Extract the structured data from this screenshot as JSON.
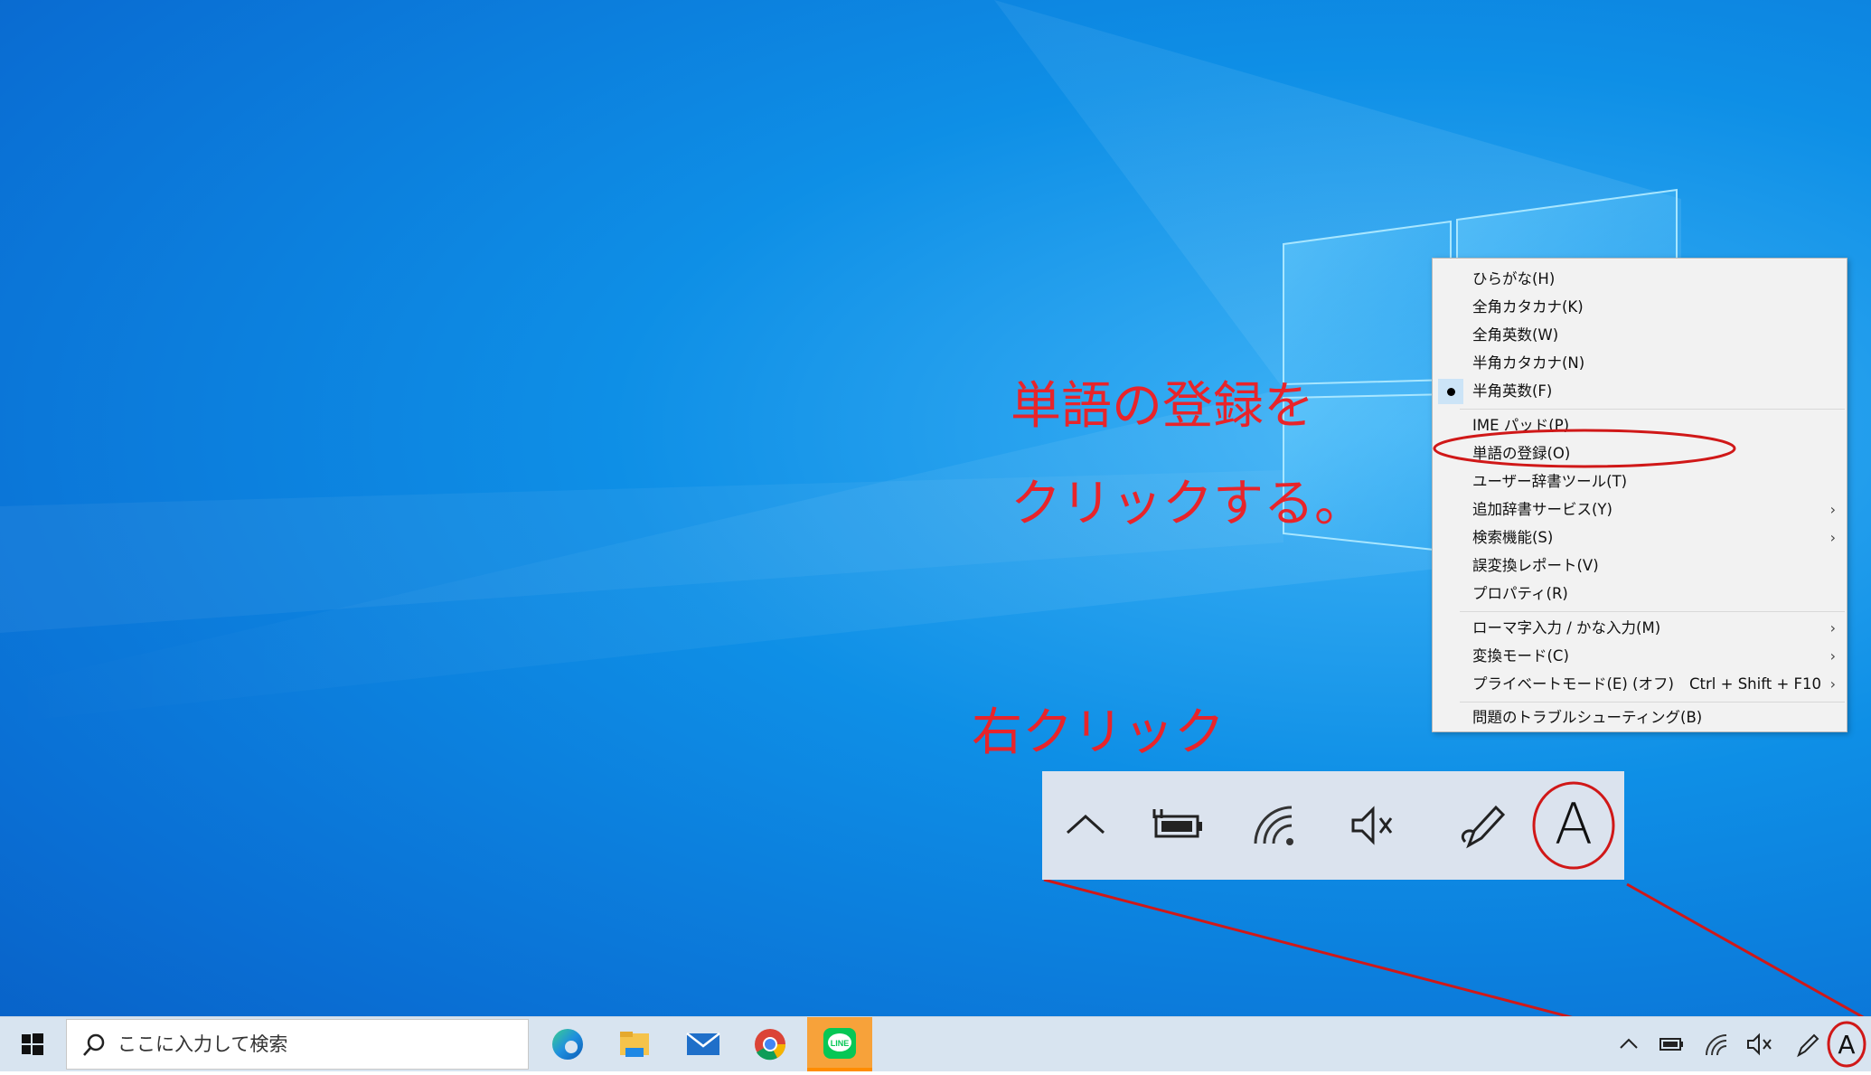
{
  "ime_menu": {
    "items": [
      {
        "label": "ひらがな(H)"
      },
      {
        "label": "全角カタカナ(K)"
      },
      {
        "label": "全角英数(W)"
      },
      {
        "label": "半角カタカナ(N)"
      },
      {
        "label": "半角英数(F)",
        "selected": true
      },
      {
        "label": "IME パッド(P)"
      },
      {
        "label": "単語の登録(O)"
      },
      {
        "label": "ユーザー辞書ツール(T)"
      },
      {
        "label": "追加辞書サービス(Y)",
        "submenu": true
      },
      {
        "label": "検索機能(S)",
        "submenu": true
      },
      {
        "label": "誤変換レポート(V)"
      },
      {
        "label": "プロパティ(R)"
      },
      {
        "label": "ローマ字入力 / かな入力(M)",
        "submenu": true
      },
      {
        "label": "変換モード(C)",
        "submenu": true
      },
      {
        "label": "プライベートモード(E) (オフ)",
        "shortcut": "Ctrl + Shift + F10",
        "submenu": true
      },
      {
        "label": "問題のトラブルシューティング(B)"
      }
    ],
    "submenu_arrow": "›"
  },
  "annotations": {
    "line1": "単語の登録を",
    "line2": "クリックする。",
    "right_click": "右クリック"
  },
  "zoom_tray": {
    "ime_letter": "A",
    "icons": [
      "chevron-up-icon",
      "battery-charging-icon",
      "wifi-icon",
      "speaker-muted-icon",
      "pen-icon",
      "ime-mode-icon"
    ]
  },
  "taskbar": {
    "search_placeholder": "ここに入力して検索",
    "apps": [
      "edge-icon",
      "file-explorer-icon",
      "mail-icon",
      "chrome-icon",
      "line-icon"
    ],
    "ime_letter": "A"
  },
  "colors": {
    "annotation": "#e8242a",
    "menu_bg": "#f2f2f2",
    "selected_bg": "#cce4f7",
    "taskbar_bg": "#d8e4f0",
    "line_active": "#ff8c00"
  }
}
